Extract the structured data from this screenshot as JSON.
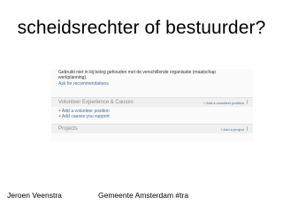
{
  "slide": {
    "title": "scheidsrechter of bestuurder?",
    "footer_author": "Jeroen Veenstra",
    "footer_org": "Gemeente Amsterdam #tra"
  },
  "screenshot": {
    "intro_line_1": "Gebruikt niet in bij beleg gehouden met de verschillende organisatie (maatschap",
    "intro_line_2": "werkplanning).",
    "ask_link": "Ask for recommendations",
    "volunteer": {
      "heading": "Volunteer Experience & Causes",
      "add_link": "+ Add a volunteer position",
      "item_1": "+ Add a volunteer position",
      "item_2": "+ Add causes you support"
    },
    "projects": {
      "heading": "Projects",
      "add_link": "+ Add a project"
    }
  }
}
